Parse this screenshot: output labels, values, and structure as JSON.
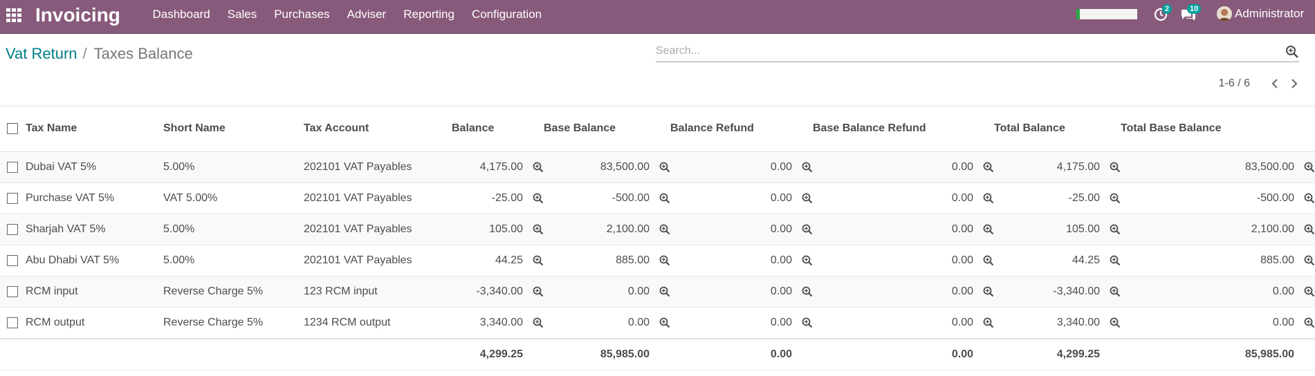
{
  "topbar": {
    "app_name": "Invoicing",
    "menu": [
      "Dashboard",
      "Sales",
      "Purchases",
      "Adviser",
      "Reporting",
      "Configuration"
    ],
    "activity_count": "2",
    "messages_count": "10",
    "user_name": "Administrator",
    "colors": {
      "brand": "#875a7b",
      "badge": "#00a09d"
    }
  },
  "breadcrumb": {
    "parent": "Vat Return",
    "separator": "/",
    "current": "Taxes Balance"
  },
  "search": {
    "placeholder": "Search..."
  },
  "pager": {
    "value": "1-6 / 6"
  },
  "table": {
    "columns": [
      "Tax Name",
      "Short Name",
      "Tax Account",
      "Balance",
      "Base Balance",
      "Balance Refund",
      "Base Balance Refund",
      "Total Balance",
      "Total Base Balance"
    ],
    "rows": [
      {
        "tax_name": "Dubai VAT 5%",
        "short_name": "5.00%",
        "tax_account": "202101 VAT Payables",
        "balance": "4,175.00",
        "base_balance": "83,500.00",
        "balance_refund": "0.00",
        "base_balance_refund": "0.00",
        "total_balance": "4,175.00",
        "total_base_balance": "83,500.00"
      },
      {
        "tax_name": "Purchase VAT 5%",
        "short_name": "VAT 5.00%",
        "tax_account": "202101 VAT Payables",
        "balance": "-25.00",
        "base_balance": "-500.00",
        "balance_refund": "0.00",
        "base_balance_refund": "0.00",
        "total_balance": "-25.00",
        "total_base_balance": "-500.00"
      },
      {
        "tax_name": "Sharjah VAT 5%",
        "short_name": "5.00%",
        "tax_account": "202101 VAT Payables",
        "balance": "105.00",
        "base_balance": "2,100.00",
        "balance_refund": "0.00",
        "base_balance_refund": "0.00",
        "total_balance": "105.00",
        "total_base_balance": "2,100.00"
      },
      {
        "tax_name": "Abu Dhabi VAT 5%",
        "short_name": "5.00%",
        "tax_account": "202101 VAT Payables",
        "balance": "44.25",
        "base_balance": "885.00",
        "balance_refund": "0.00",
        "base_balance_refund": "0.00",
        "total_balance": "44.25",
        "total_base_balance": "885.00"
      },
      {
        "tax_name": "RCM input",
        "short_name": "Reverse Charge 5%",
        "tax_account": "123 RCM input",
        "balance": "-3,340.00",
        "base_balance": "0.00",
        "balance_refund": "0.00",
        "base_balance_refund": "0.00",
        "total_balance": "-3,340.00",
        "total_base_balance": "0.00"
      },
      {
        "tax_name": "RCM output",
        "short_name": "Reverse Charge 5%",
        "tax_account": "1234 RCM output",
        "balance": "3,340.00",
        "base_balance": "0.00",
        "balance_refund": "0.00",
        "base_balance_refund": "0.00",
        "total_balance": "3,340.00",
        "total_base_balance": "0.00"
      }
    ],
    "totals": {
      "balance": "4,299.25",
      "base_balance": "85,985.00",
      "balance_refund": "0.00",
      "base_balance_refund": "0.00",
      "total_balance": "4,299.25",
      "total_base_balance": "85,985.00"
    }
  }
}
